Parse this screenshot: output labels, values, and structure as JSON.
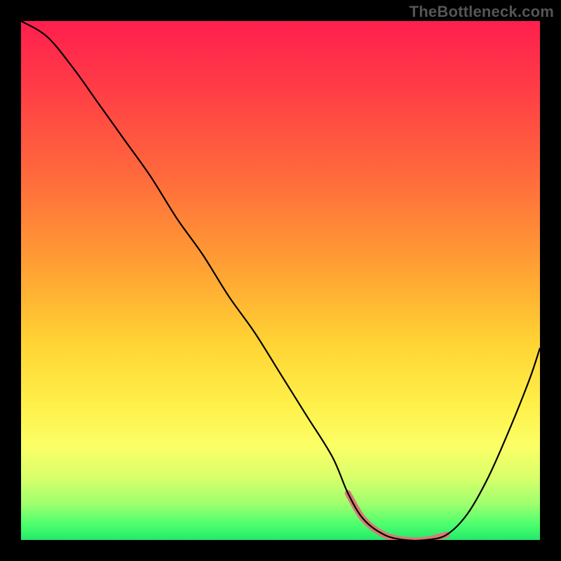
{
  "watermark": "TheBottleneck.com",
  "colors": {
    "background": "#000000",
    "gradient_top": "#ff1f4e",
    "gradient_bottom": "#24e86a",
    "curve": "#000000",
    "marker": "#d97a75",
    "watermark": "#555555"
  },
  "chart_data": {
    "type": "line",
    "title": "",
    "xlabel": "",
    "ylabel": "",
    "xlim": [
      0,
      100
    ],
    "ylim": [
      0,
      100
    ],
    "grid": false,
    "series": [
      {
        "name": "bottleneck-curve",
        "x": [
          0,
          5,
          10,
          15,
          20,
          25,
          30,
          35,
          40,
          45,
          50,
          55,
          60,
          63,
          66,
          70,
          74,
          78,
          82,
          86,
          90,
          94,
          98,
          100
        ],
        "y": [
          100,
          97,
          91,
          84,
          77,
          70,
          62,
          55,
          47,
          40,
          32,
          24,
          16,
          9,
          4,
          1,
          0,
          0,
          1,
          5,
          12,
          21,
          31,
          37
        ]
      }
    ],
    "annotations": [
      {
        "name": "optimal-range",
        "x_start": 63,
        "x_end": 82,
        "description": "sweet-spot segment highlighted near bottom"
      }
    ]
  }
}
